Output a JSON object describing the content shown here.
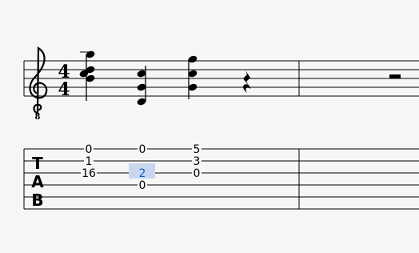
{
  "score": {
    "time_signature": {
      "numerator": "4",
      "denominator": "4"
    },
    "clef": {
      "name": "treble-8vb",
      "octave_mark": "8"
    },
    "tab_clef": {
      "letters": [
        "T",
        "A",
        "B"
      ]
    },
    "selection_color": "#c9d7ee",
    "tab_columns": [
      {
        "frets": [
          "0",
          "1",
          "16"
        ]
      },
      {
        "frets": [
          "0",
          "2",
          "0"
        ]
      },
      {
        "frets": [
          "5",
          "3",
          "0"
        ]
      }
    ],
    "selected_fret": {
      "column": 1,
      "string": 3
    }
  }
}
